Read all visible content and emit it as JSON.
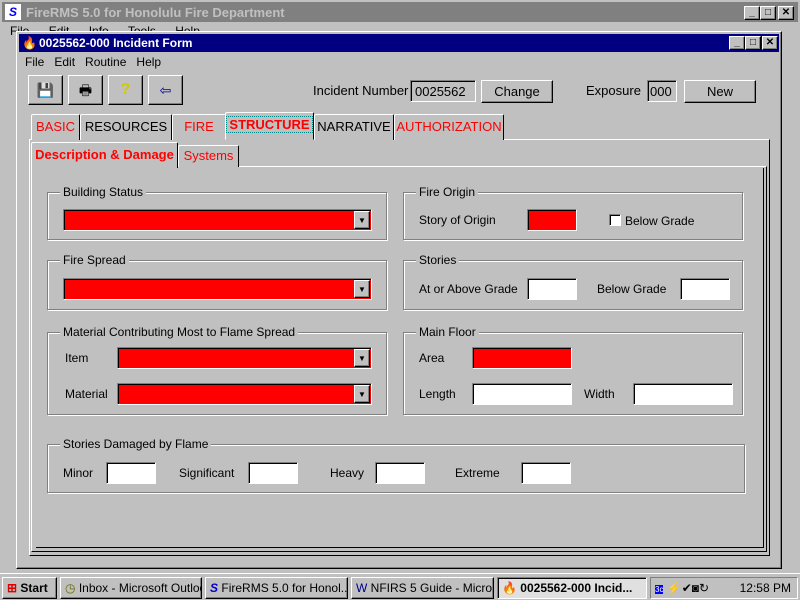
{
  "parent": {
    "title": "FireRMS 5.0 for Honolulu Fire Department",
    "menu": [
      "File",
      "Edit",
      "Info",
      "Tools",
      "Help"
    ]
  },
  "window": {
    "title": "0025562-000 Incident Form",
    "menu": [
      "File",
      "Edit",
      "Routine",
      "Help"
    ]
  },
  "toolbar": {
    "buttons": [
      "save-icon",
      "print-icon",
      "help-icon",
      "exit-icon"
    ]
  },
  "incident": {
    "number_label": "Incident Number",
    "number": "0025562",
    "change": "Change",
    "exposure_label": "Exposure",
    "exposure": "000",
    "new": "New"
  },
  "tabs": [
    "BASIC",
    "RESOURCES",
    "FIRE",
    "STRUCTURE",
    "NARRATIVE",
    "AUTHORIZATION"
  ],
  "subtabs": [
    "Description & Damage",
    "Systems"
  ],
  "form": {
    "building_status": "Building Status",
    "fire_origin": "Fire Origin",
    "story_of_origin": "Story of Origin",
    "below_grade_check": "Below Grade",
    "fire_spread": "Fire Spread",
    "stories": "Stories",
    "at_above": "At or Above Grade",
    "below_grade": "Below Grade",
    "material_group": "Material Contributing Most to Flame Spread",
    "item": "Item",
    "material": "Material",
    "main_floor": "Main Floor",
    "area": "Area",
    "length": "Length",
    "width": "Width",
    "damaged": "Stories Damaged by Flame",
    "minor": "Minor",
    "significant": "Significant",
    "heavy": "Heavy",
    "extreme": "Extreme"
  },
  "colors": {
    "required": "#ff0000",
    "titlebar": "#000080"
  },
  "taskbar": {
    "start": "Start",
    "items": [
      "Inbox - Microsoft Outlook",
      "FireRMS 5.0 for Honol...",
      "NFIRS 5 Guide - Micro...",
      "0025562-000 Incid..."
    ],
    "clock": "12:58 PM"
  }
}
